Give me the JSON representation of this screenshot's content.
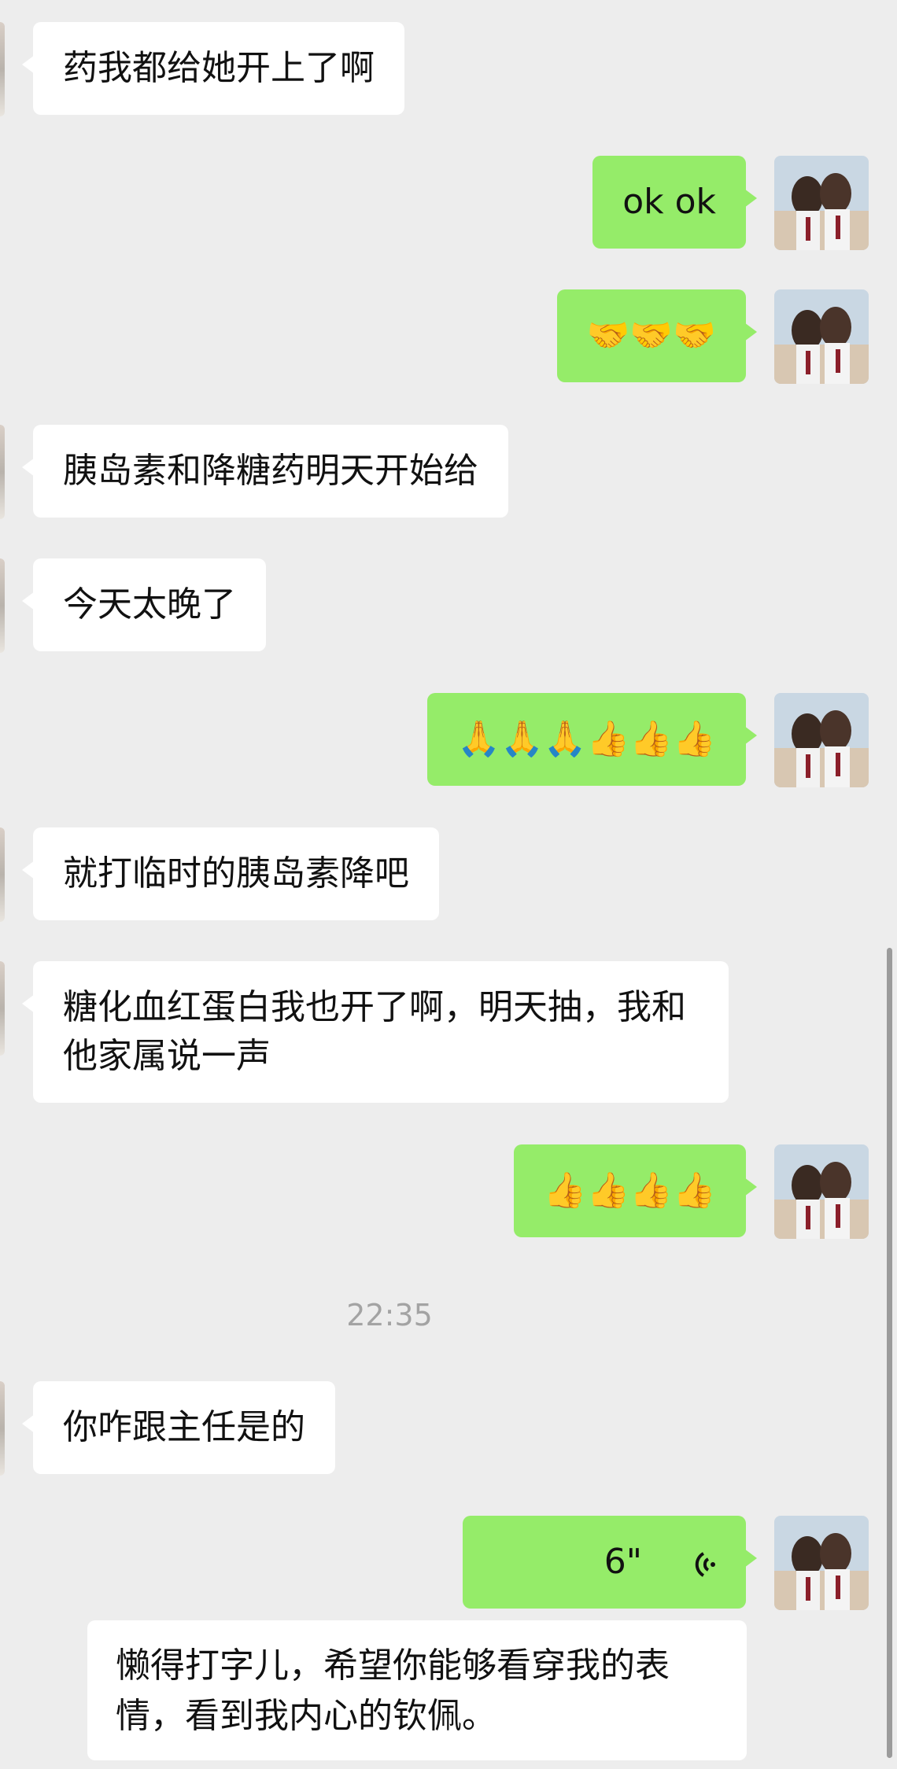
{
  "messages": {
    "m1": "药我都给她开上了啊",
    "m2": "ok ok",
    "m3": "🤝🤝🤝",
    "m4": "胰岛素和降糖药明天开始给",
    "m5": "今天太晚了",
    "m6": "🙏🙏🙏👍👍👍",
    "m7": "就打临时的胰岛素降吧",
    "m8": "糖化血红蛋白我也开了啊，明天抽，我和他家属说一声",
    "m9": "👍👍👍👍",
    "m10": "你咋跟主任是的",
    "voice_duration": "6\""
  },
  "timestamp": "22:35",
  "caption": "懒得打字儿，希望你能够看穿我的表情，看到我内心的钦佩。",
  "colors": {
    "background": "#ededed",
    "outgoing_bubble": "#95ec69",
    "incoming_bubble": "#ffffff"
  },
  "icons": {
    "voice": "voice-wave-icon",
    "avatar": "user-avatar-photo"
  }
}
